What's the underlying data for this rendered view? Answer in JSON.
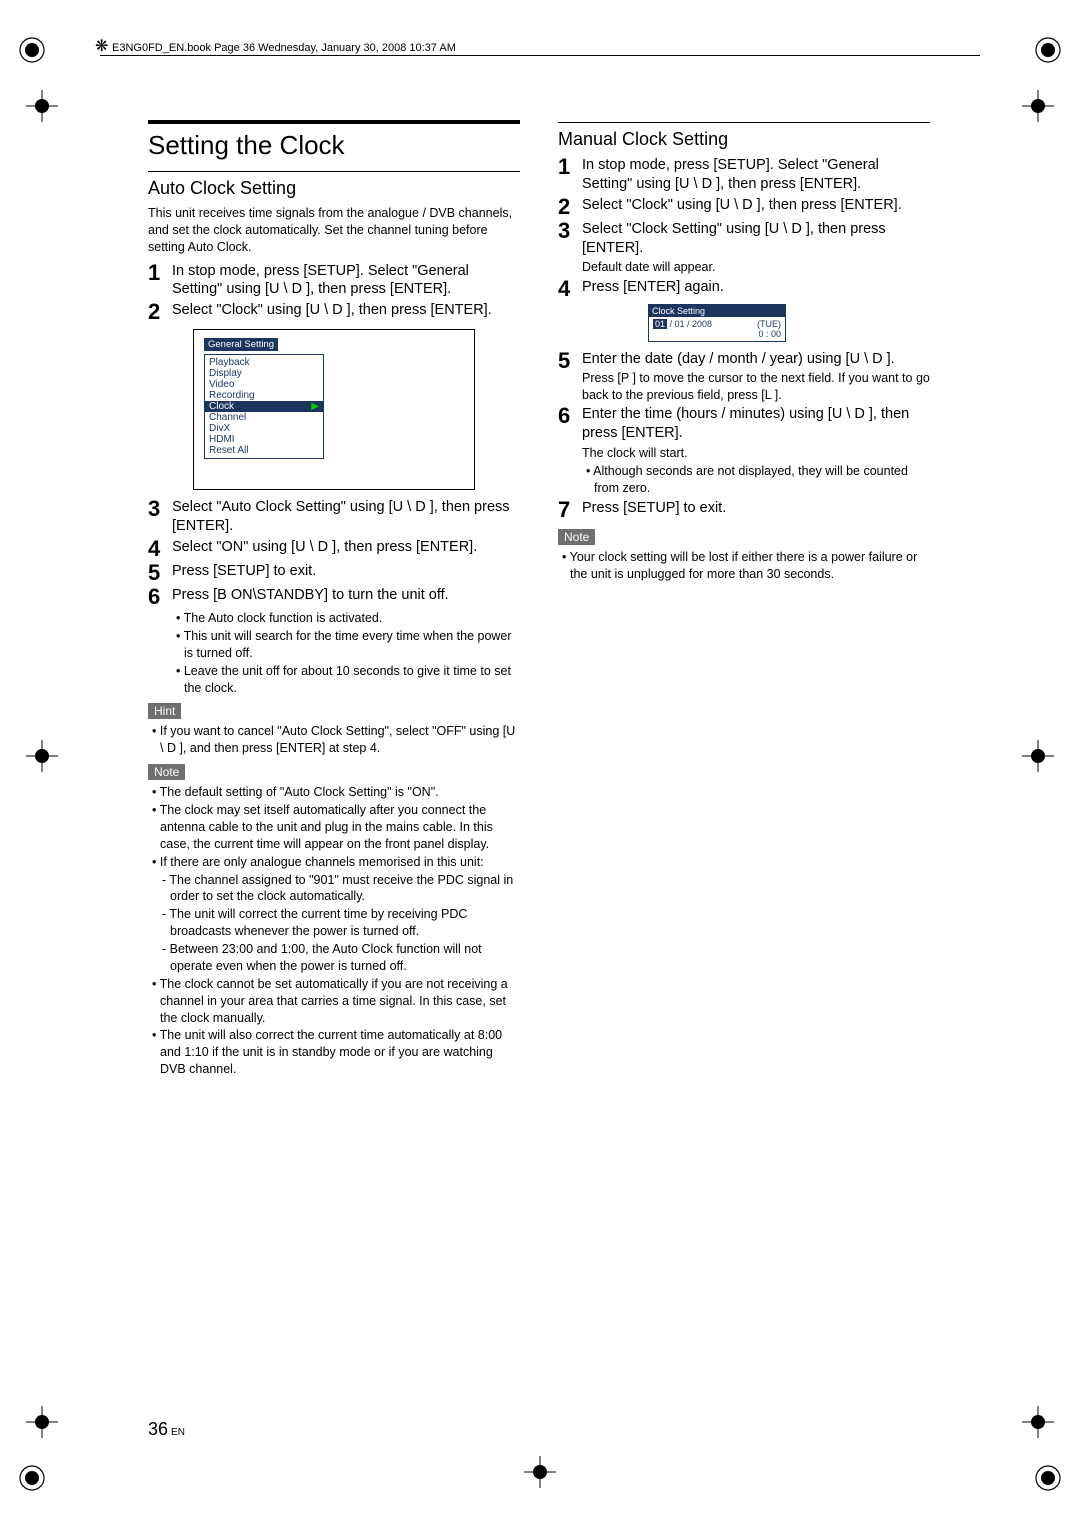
{
  "header": {
    "decor_glyph": "❋",
    "text": "E3NG0FD_EN.book  Page 36  Wednesday, January 30, 2008  10:37 AM"
  },
  "left": {
    "h1": "Setting the Clock",
    "h2": "Auto Clock Setting",
    "intro": "This unit receives time signals from the analogue / DVB channels, and set the clock automatically. Set the channel tuning before setting Auto Clock.",
    "steps": [
      "In stop mode, press [SETUP]. Select \"General Setting\" using [U \\ D ], then press [ENTER].",
      "Select \"Clock\" using [U \\ D ], then press [ENTER].",
      "Select \"Auto Clock Setting\" using [U \\ D ], then press [ENTER].",
      "Select \"ON\" using [U \\ D ], then press [ENTER].",
      "Press [SETUP] to exit.",
      "Press [B  ON\\STANDBY] to turn the unit off."
    ],
    "step6_sub": [
      "The Auto clock function is activated.",
      "This unit will search for the time every time when the power is turned off.",
      "Leave the unit off for about 10 seconds to give it time to set the clock."
    ],
    "osd": {
      "title": "General Setting",
      "items": [
        "Playback",
        "Display",
        "Video",
        "Recording",
        "Clock",
        "Channel",
        "DivX",
        "HDMI",
        "Reset All"
      ],
      "selected_index": 4
    },
    "hint_label": "Hint",
    "hint_bullets": [
      "If you want to cancel \"Auto Clock Setting\", select \"OFF\" using [U \\ D ], and then press [ENTER] at step 4."
    ],
    "note_label": "Note",
    "note_bullets": [
      "The default setting of \"Auto Clock Setting\" is \"ON\".",
      "The clock may set itself automatically after you connect the antenna cable to the unit and plug in the mains cable. In this case, the current time will appear on the front panel display.",
      "If there are only analogue channels memorised in this unit:"
    ],
    "note_subdash": [
      "The channel assigned to \"901\" must receive the PDC signal in order to set the clock automatically.",
      "The unit will correct the current time by receiving PDC broadcasts whenever the power is turned off.",
      "Between 23:00 and 1:00, the Auto Clock function will not operate even when the power is turned off."
    ],
    "note_bullets_after": [
      "The clock cannot be set automatically if you are not receiving a channel in your area that carries a time signal. In this case, set the clock manually.",
      "The unit will also correct the current time automatically at 8:00 and 1:10 if the unit is in standby mode or if you are watching DVB channel."
    ]
  },
  "right": {
    "h2": "Manual Clock Setting",
    "steps": [
      {
        "text": "In stop mode, press [SETUP]. Select \"General Setting\" using [U \\ D ], then press [ENTER]."
      },
      {
        "text": "Select \"Clock\" using [U \\ D ], then press [ENTER]."
      },
      {
        "text": "Select \"Clock Setting\" using [U \\ D ], then press [ENTER].",
        "small": "Default date will appear."
      },
      {
        "text": "Press [ENTER] again."
      },
      {
        "text": "Enter the date (day / month / year) using [U \\ D ].",
        "small": "Press [P ] to move the cursor to the next field. If you want to go back to the previous field, press [L ]."
      },
      {
        "text": "Enter the time (hours / minutes) using [U \\ D ], then press [ENTER].",
        "small": "The clock will start.",
        "bullet": "Although seconds are not displayed, they will be counted from zero."
      },
      {
        "text": "Press [SETUP] to exit."
      }
    ],
    "osd": {
      "title": "Clock Setting",
      "day": "01",
      "rest_date": "/ 01 / 2008",
      "dow": "(TUE)",
      "time": "0 : 00"
    },
    "note_label": "Note",
    "note_bullets": [
      "Your clock setting will be lost if either there is a power failure or the unit is unplugged for more than 30 seconds."
    ]
  },
  "page": {
    "num": "36",
    "lang": "EN"
  }
}
